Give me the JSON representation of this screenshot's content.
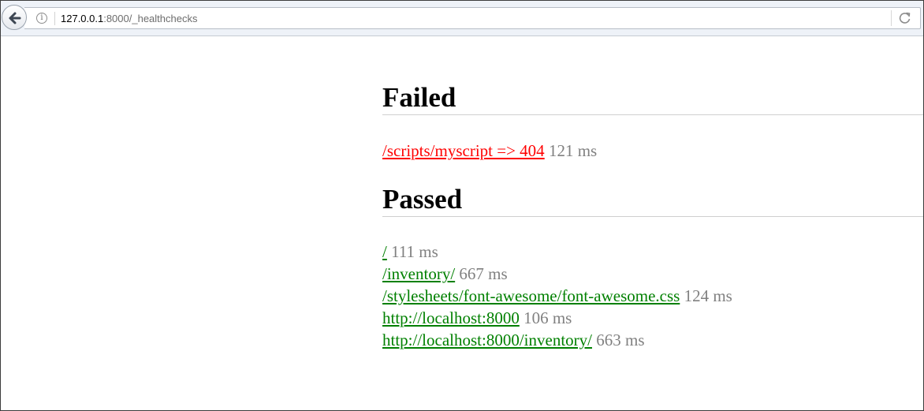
{
  "browser": {
    "url_host": "127.0.0.1",
    "url_path": ":8000/_healthchecks",
    "back_icon": "arrow-left-icon",
    "info_icon": "info-icon",
    "reload_icon": "reload-icon"
  },
  "failed": {
    "heading": "Failed",
    "items": [
      {
        "link": "/scripts/myscript => 404",
        "time": "121 ms"
      }
    ]
  },
  "passed": {
    "heading": "Passed",
    "items": [
      {
        "link": "/",
        "time": "111 ms"
      },
      {
        "link": "/inventory/",
        "time": "667 ms"
      },
      {
        "link": "/stylesheets/font-awesome/font-awesome.css",
        "time": "124 ms"
      },
      {
        "link": "http://localhost:8000",
        "time": "106 ms"
      },
      {
        "link": "http://localhost:8000/inventory/",
        "time": "663 ms"
      }
    ]
  },
  "colors": {
    "failed_link": "#ff0000",
    "passed_link": "#008000",
    "time_text": "#808080"
  }
}
